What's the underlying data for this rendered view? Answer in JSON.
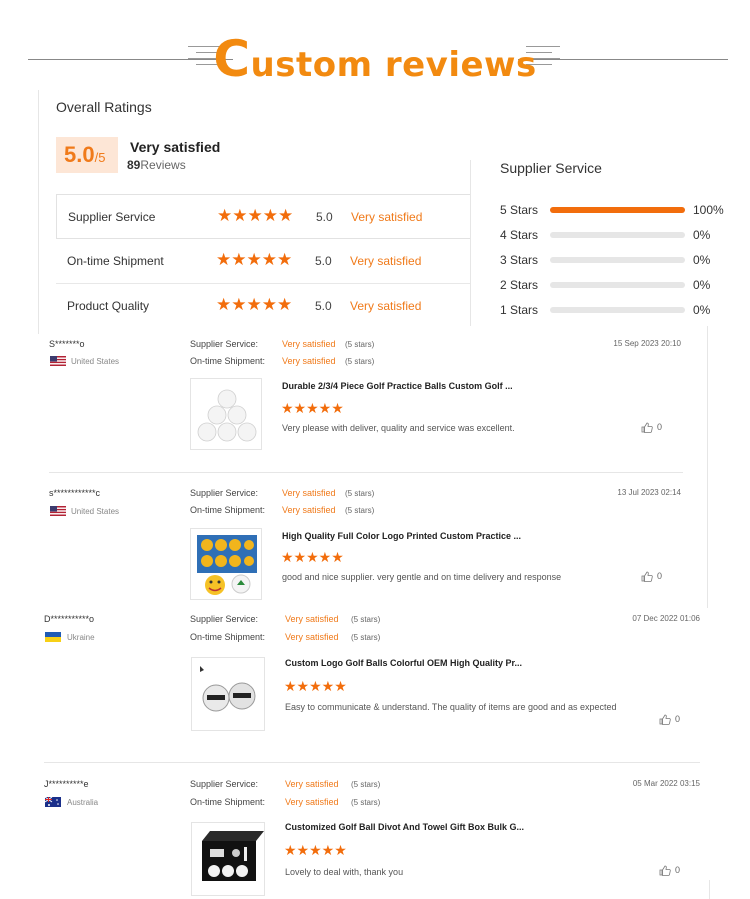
{
  "header": {
    "title_big": "C",
    "title_rest": "ustom reviews"
  },
  "overall": {
    "title": "Overall Ratings",
    "score": "5.0",
    "score_max": "/5",
    "verdict": "Very satisfied",
    "review_count": "89",
    "reviews_label": "Reviews",
    "categories": [
      {
        "name": "Supplier Service",
        "stars": "★★★★★",
        "score": "5.0",
        "verdict": "Very satisfied"
      },
      {
        "name": "On-time Shipment",
        "stars": "★★★★★",
        "score": "5.0",
        "verdict": "Very satisfied"
      },
      {
        "name": "Product Quality",
        "stars": "★★★★★",
        "score": "5.0",
        "verdict": "Very satisfied"
      }
    ]
  },
  "supplier_service": {
    "title": "Supplier Service",
    "bars": [
      {
        "label": "5 Stars",
        "pct": "100%",
        "fraction": 1.0
      },
      {
        "label": "4 Stars",
        "pct": "0%",
        "fraction": 0
      },
      {
        "label": "3 Stars",
        "pct": "0%",
        "fraction": 0
      },
      {
        "label": "2 Stars",
        "pct": "0%",
        "fraction": 0
      },
      {
        "label": "1 Stars",
        "pct": "0%",
        "fraction": 0
      }
    ]
  },
  "labels": {
    "supplier_service": "Supplier Service:",
    "ontime_shipment": "On-time Shipment:",
    "very_satisfied": "Very satisfied",
    "five_stars": "(5 stars)",
    "star_row": "★★★★★"
  },
  "reviews": [
    {
      "name": "S*******o",
      "country": "United States",
      "date": "15 Sep 2023 20:10",
      "product": "Durable 2/3/4 Piece Golf Practice Balls Custom Golf ...",
      "text": "Very please with deliver, quality and service was excellent.",
      "likes": "0"
    },
    {
      "name": "s************c",
      "country": "United States",
      "date": "13 Jul 2023 02:14",
      "product": "High Quality Full Color Logo Printed Custom Practice ...",
      "text": "good and nice supplier. very gentle and on time delivery and response",
      "likes": "0"
    },
    {
      "name": "D***********o",
      "country": "Ukraine",
      "date": "07 Dec 2022 01:06",
      "product": "Custom Logo Golf Balls Colorful OEM High Quality Pr...",
      "text": "Easy to communicate & understand. The quality of items are good and as expected",
      "likes": "0"
    },
    {
      "name": "J**********e",
      "country": "Australia",
      "date": "05 Mar 2022 03:15",
      "product": "Customized Golf Ball Divot And Towel Gift Box Bulk G...",
      "text": "Lovely to deal with, thank you",
      "likes": "0"
    }
  ]
}
